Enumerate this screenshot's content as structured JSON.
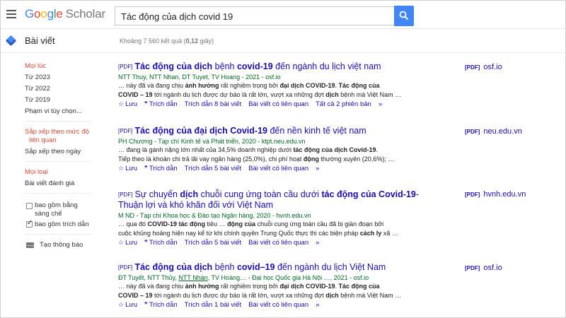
{
  "header": {
    "logo_letters": [
      "G",
      "o",
      "o",
      "g",
      "l",
      "e"
    ],
    "logo_product": "Scholar",
    "search_value": "Tác động của dịch covid 19"
  },
  "subbar": {
    "section_title": "Bài viết",
    "results_count_prefix": "Khoảng 7 560 kết quả (",
    "results_count_time": "0,12",
    "results_count_suffix": " giây)"
  },
  "sidebar": {
    "time_filters": [
      "Mọi lúc",
      "Từ 2023",
      "Từ 2022",
      "Từ 2019",
      "Phạm vi tùy chọn..."
    ],
    "sort_filters": [
      "Sắp xếp theo mức độ",
      "liên quan",
      "Sắp xếp theo ngày"
    ],
    "type_filters": [
      "Mọi loại",
      "Bài viết đánh giá"
    ],
    "include_patents": [
      "bao gồm bằng",
      "sáng chế"
    ],
    "include_citations": "bao gồm trích dẫn",
    "create_alert": "Tạo thông báo"
  },
  "results": [
    {
      "tag": "[PDF]",
      "title_parts": [
        [
          "b",
          "Tác động của dịch"
        ],
        [
          "n",
          " bệnh "
        ],
        [
          "b",
          "covid-19"
        ],
        [
          "n",
          " đến ngành du lịch việt nam"
        ]
      ],
      "authors": "NTT Thuy, NTT Nhan, DT Tuyet, TV Hoang - 2021 - osf.io",
      "snippet1_parts": [
        [
          "n",
          "… này đã và đang chịu "
        ],
        [
          "b",
          "ảnh hưởng"
        ],
        [
          "n",
          " rất nghiêm trọng bởi "
        ],
        [
          "b",
          "đại dịch COVID-19"
        ],
        [
          "n",
          ". "
        ],
        [
          "b",
          "Tác động của"
        ]
      ],
      "snippet2_parts": [
        [
          "b",
          "COVID – 19"
        ],
        [
          "n",
          " tới ngành du lịch được dự báo là rất lớn, vượt xa những đợt "
        ],
        [
          "b",
          "dịch"
        ],
        [
          "n",
          " bệnh mà Việt Nam …"
        ]
      ],
      "links": [
        "Lưu",
        "Trích dẫn",
        "Trích dẫn 8 bài viết",
        "Bài viết có liên quan",
        "Tất cả 2 phiên bản"
      ],
      "side_tag": "[PDF]",
      "side_source": "osf.io"
    },
    {
      "tag": "[PDF]",
      "title_parts": [
        [
          "b",
          "Tác động của đại dịch Covid-19"
        ],
        [
          "n",
          " đến nền kinh tế việt nam"
        ]
      ],
      "authors": "PH Chương - Tạp chí Kinh tế và Phát triển, 2020 - ktpt.neu.edu.vn",
      "snippet1_parts": [
        [
          "n",
          "… đang là gánh nặng lớn nhất của 34,5% doanh nghiệp dưới "
        ],
        [
          "b",
          "tác động của dịch Covid-19"
        ],
        [
          "n",
          "."
        ]
      ],
      "snippet2_parts": [
        [
          "n",
          "Tiếp theo là khoản chi trả lãi vay ngân hàng (25,0%), chi phí hoạt "
        ],
        [
          "b",
          "động"
        ],
        [
          "n",
          " thường xuyên (20,6%); …"
        ]
      ],
      "links": [
        "Lưu",
        "Trích dẫn",
        "Trích dẫn 5 bài viết",
        "Bài viết có liên quan"
      ],
      "side_tag": "[PDF]",
      "side_source": "neu.edu.vn"
    },
    {
      "tag": "[PDF]",
      "title_parts": [
        [
          "n",
          "Sự chuyển "
        ],
        [
          "b",
          "dịch"
        ],
        [
          "n",
          " chuỗi cung ứng toàn cầu dưới "
        ],
        [
          "b",
          "tác động của Covid-19"
        ],
        [
          "n",
          "- Thuận lợi và khó khăn đối với Việt Nam"
        ]
      ],
      "authors": "M ND - Tạp chí Khoa học & Đào tạo Ngân hàng, 2020 - hvnh.edu.vn",
      "snippet1_parts": [
        [
          "n",
          "… qua đó "
        ],
        [
          "b",
          "COVID-19 tác động"
        ],
        [
          "n",
          " tiêu … "
        ],
        [
          "b",
          "động của"
        ],
        [
          "n",
          " chuỗi cung ứng toàn cầu đã bị gián đoạn bởi"
        ]
      ],
      "snippet2_parts": [
        [
          "n",
          "cuộc khủng hoảng hiện nay kể từ khi chính quyền Trung Quốc thực thi các biện pháp "
        ],
        [
          "b",
          "cách ly"
        ],
        [
          "n",
          " xã …"
        ]
      ],
      "links": [
        "Lưu",
        "Trích dẫn",
        "Trích dẫn 5 bài viết",
        "Bài viết có liên quan"
      ],
      "side_tag": "[PDF]",
      "side_source": "hvnh.edu.vn"
    },
    {
      "tag": "[PDF]",
      "title_parts": [
        [
          "b",
          "Tác động của dịch"
        ],
        [
          "n",
          " bệnh "
        ],
        [
          "b",
          "covid–19"
        ],
        [
          "n",
          " đến ngành du lịch Việt Nam"
        ]
      ],
      "authors_pre": "ĐT Tuyết, NTT Thủy, ",
      "authors_link": "NTT Nhàn",
      "authors_post": ", TV Hoàng… - Đại học Quốc gia Hà Nội …, 2021 - osf.io",
      "snippet1_parts": [
        [
          "n",
          "… này đã và đang chịu "
        ],
        [
          "b",
          "ảnh hưởng"
        ],
        [
          "n",
          " rất nghiêm trọng bởi "
        ],
        [
          "b",
          "đại dịch COVID-19"
        ],
        [
          "n",
          ". "
        ],
        [
          "b",
          "Tác động của"
        ]
      ],
      "snippet2_parts": [
        [
          "b",
          "COVID – 19"
        ],
        [
          "n",
          " tới ngành du lịch được dự báo là rất lớn, vượt xa những đợt "
        ],
        [
          "b",
          "dịch"
        ],
        [
          "n",
          " bệnh mà Việt Nam …"
        ]
      ],
      "links": [
        "Lưu",
        "Trích dẫn",
        "Trích dẫn 1 bài viết",
        "Bài viết có liên quan"
      ],
      "side_tag": "[PDF]",
      "side_source": "osf.io"
    }
  ],
  "colors": {
    "link": "#1a0dab",
    "author_green": "#006621",
    "filter_red": "#d14836",
    "search_button": "#4285f4"
  },
  "icons": {
    "menu": "hamburger-icon",
    "search": "search-icon",
    "articles": "articles-icon",
    "save": "star-icon",
    "cite": "quote-icon",
    "more": "double-chevron-icon",
    "alert": "envelope-icon"
  }
}
